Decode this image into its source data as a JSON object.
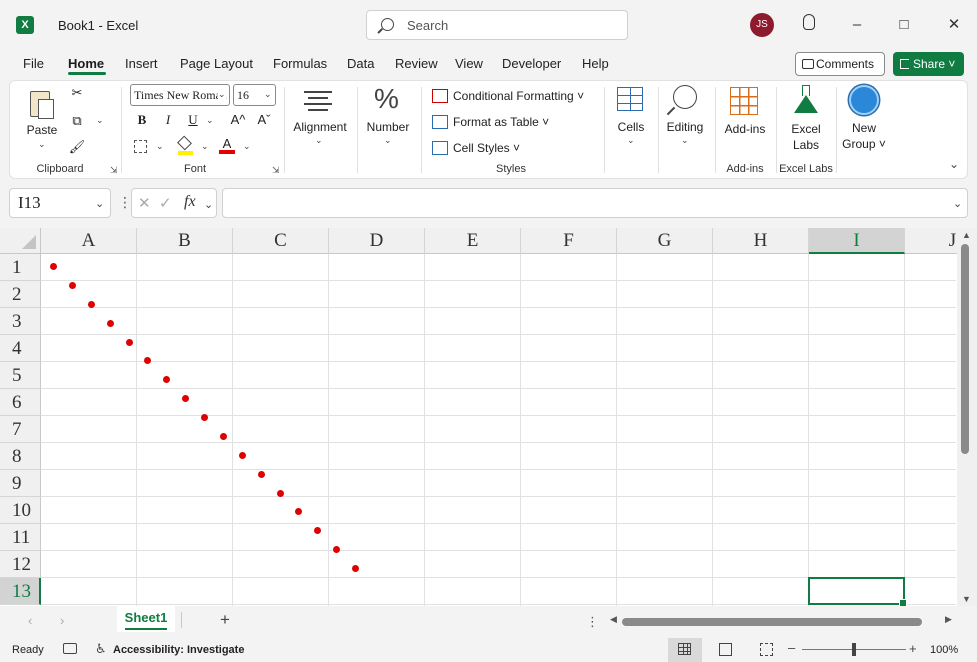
{
  "titlebar": {
    "app_icon": "excel-logo-icon",
    "title": "Book1  -  Excel",
    "search_placeholder": "Search",
    "user_initials": "JS",
    "icons": [
      "lightbulb-icon",
      "minimize-icon",
      "maximize-icon",
      "close-icon"
    ]
  },
  "menu": {
    "tabs": [
      "File",
      "Home",
      "Insert",
      "Page Layout",
      "Formulas",
      "Data",
      "Review",
      "View",
      "Developer",
      "Help"
    ],
    "active": "Home",
    "comments_label": "Comments",
    "share_label": "Share"
  },
  "ribbon": {
    "clipboard": {
      "label": "Clipboard",
      "paste": "Paste"
    },
    "font": {
      "label": "Font",
      "name": "Times New Roman",
      "size": "16",
      "bold": "B",
      "italic": "I",
      "underline": "U",
      "grow": "A^",
      "shrink": "Aˇ"
    },
    "alignment": "Alignment",
    "number": "Number",
    "styles": {
      "label": "Styles",
      "conditional": "Conditional Formatting",
      "format_table": "Format as Table",
      "cell_styles": "Cell Styles"
    },
    "cells": "Cells",
    "editing": "Editing",
    "addins": {
      "button": "Add-ins",
      "label": "Add-ins"
    },
    "excel_labs": {
      "button_line1": "Excel",
      "button_line2": "Labs",
      "label": "Excel Labs"
    },
    "new_group": {
      "line1": "New",
      "line2": "Group"
    }
  },
  "formula_bar": {
    "name_box": "I13",
    "fx": "fx",
    "formula": ""
  },
  "grid": {
    "columns": [
      "A",
      "B",
      "C",
      "D",
      "E",
      "F",
      "G",
      "H",
      "I",
      "J"
    ],
    "rows": [
      "1",
      "2",
      "3",
      "4",
      "5",
      "6",
      "7",
      "8",
      "9",
      "10",
      "11",
      "12",
      "13"
    ],
    "selected_column": "I",
    "selected_row": "13",
    "dot_color": "#e00000",
    "dot_count": 17
  },
  "sheets": {
    "tabs": [
      "Sheet1"
    ],
    "active": "Sheet1",
    "add": "+"
  },
  "status": {
    "ready": "Ready",
    "accessibility": "Accessibility: Investigate",
    "zoom": "100%"
  }
}
